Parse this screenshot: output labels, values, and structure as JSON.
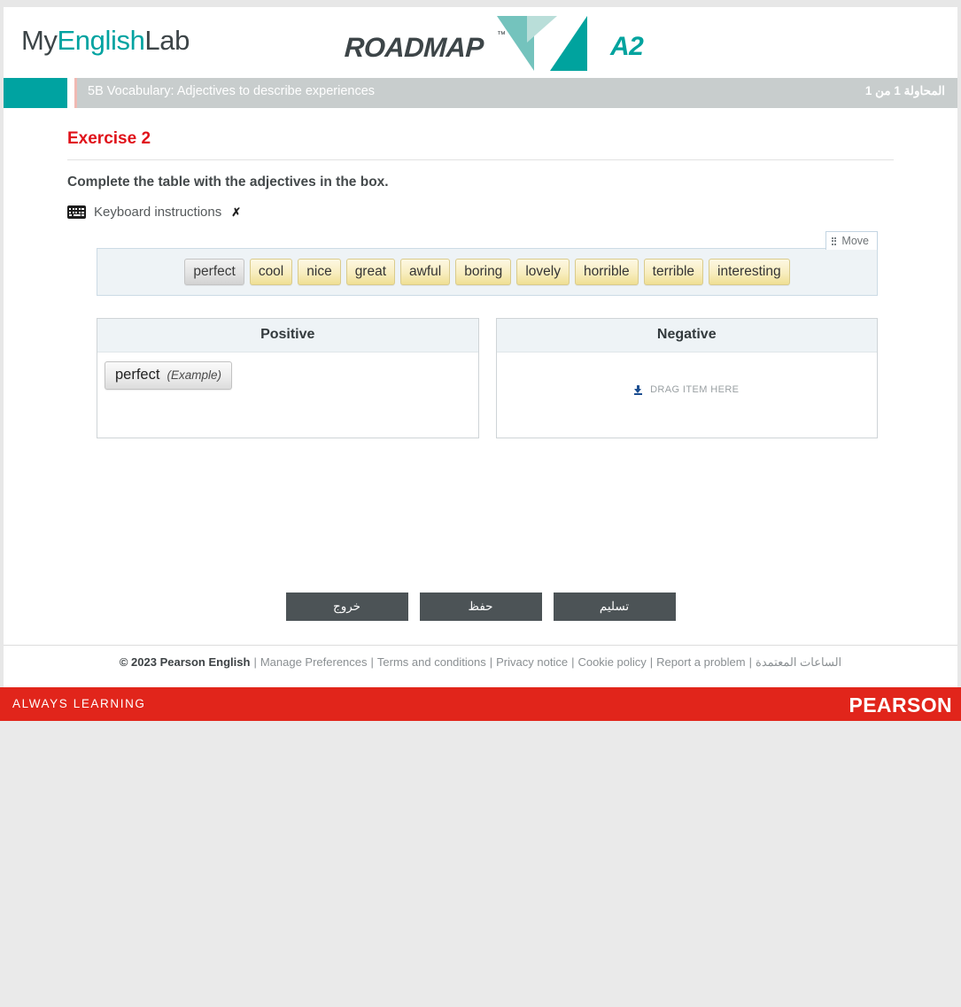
{
  "brand": {
    "mel_prefix": "My",
    "mel_mid": "English",
    "mel_suffix": "Lab",
    "roadmap_word": "ROADMAP",
    "roadmap_tm": "™",
    "roadmap_level": "A2",
    "teal": "#00a3a1",
    "red": "#e1251b"
  },
  "titlebar": {
    "lesson": "5B Vocabulary: Adjectives to describe experiences",
    "attempt": "المحاولة 1 من 1"
  },
  "exercise": {
    "heading": "Exercise 2",
    "instruction": "Complete the table with the adjectives in the box.",
    "keyboard_label": "Keyboard instructions",
    "keyboard_chevron": "❯"
  },
  "wordbank": {
    "move_label": "Move",
    "tiles": [
      {
        "label": "perfect",
        "state": "used"
      },
      {
        "label": "cool",
        "state": "available"
      },
      {
        "label": "nice",
        "state": "available"
      },
      {
        "label": "great",
        "state": "available"
      },
      {
        "label": "awful",
        "state": "available"
      },
      {
        "label": "boring",
        "state": "available"
      },
      {
        "label": "lovely",
        "state": "available"
      },
      {
        "label": "horrible",
        "state": "available"
      },
      {
        "label": "terrible",
        "state": "available"
      },
      {
        "label": "interesting",
        "state": "available"
      }
    ]
  },
  "table": {
    "positive": {
      "header": "Positive",
      "answer_word": "perfect",
      "answer_hint": "(Example)"
    },
    "negative": {
      "header": "Negative",
      "drop_hint": "DRAG ITEM HERE"
    }
  },
  "actions": {
    "exit": "خروج",
    "save": "حفظ",
    "submit": "تسليم"
  },
  "footer": {
    "copyright": "© 2023 Pearson English",
    "links": [
      "Manage Preferences",
      "Terms and conditions",
      "Privacy notice",
      "Cookie policy",
      "Report a problem",
      "الساعات المعتمدة"
    ],
    "separator": "|"
  },
  "pearson": {
    "tagline": "ALWAYS LEARNING",
    "wordmark": "PEARSON"
  }
}
